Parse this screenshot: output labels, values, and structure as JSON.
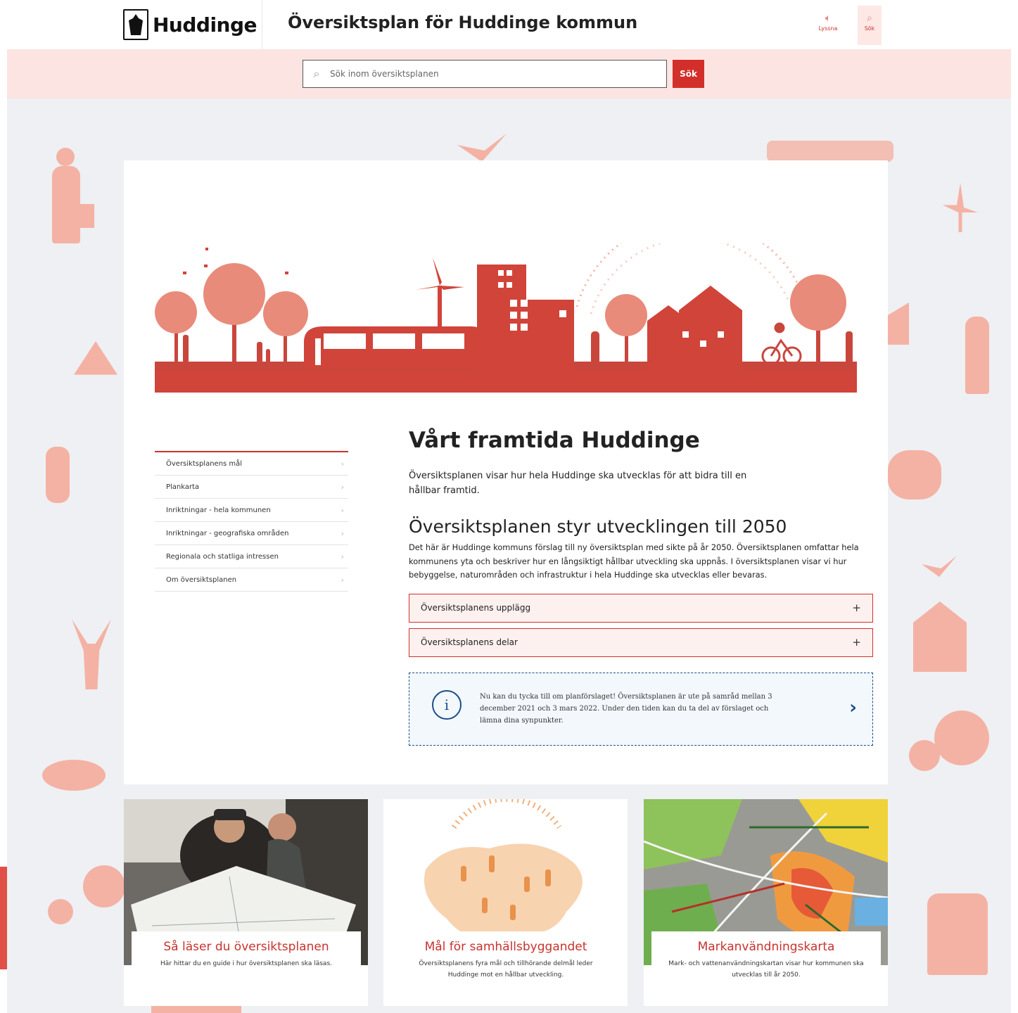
{
  "header": {
    "logo_text": "Huddinge",
    "title": "Översiktsplan för Huddinge kommun",
    "tools": [
      {
        "label": "Lyssna",
        "icon": "speaker-icon"
      },
      {
        "label": "Sök",
        "icon": "search-icon"
      }
    ]
  },
  "search": {
    "placeholder": "Sök inom översiktsplanen",
    "button_label": "Sök"
  },
  "sidenav": {
    "items": [
      {
        "label": "Översiktsplanens mål"
      },
      {
        "label": "Plankarta"
      },
      {
        "label": "Inriktningar - hela kommunen"
      },
      {
        "label": "Inriktningar - geografiska områden"
      },
      {
        "label": "Regionala och statliga intressen"
      },
      {
        "label": "Om översiktsplanen"
      }
    ]
  },
  "main": {
    "heading": "Vårt framtida Huddinge",
    "lead": "Översiktsplanen visar hur hela Huddinge ska utvecklas för att bidra till en hållbar framtid.",
    "subheading": "Översiktsplanen styr utvecklingen till 2050",
    "body": "Det här är Huddinge kommuns förslag till ny översiktsplan med sikte på år 2050. Översiktsplanen omfattar hela kommunens yta och beskriver hur en långsiktigt hållbar utveckling ska uppnås. I översiktsplanen visar vi hur bebyggelse, naturområden och infrastruktur i hela Huddinge ska utvecklas eller bevaras.",
    "accordions": [
      {
        "label": "Översiktsplanens upplägg",
        "toggle": "+"
      },
      {
        "label": "Översiktsplanens delar",
        "toggle": "+"
      }
    ],
    "notice": {
      "text": "Nu kan du tycka till om planförslaget! Översiktsplanen är ute på samråd mellan 3 december 2021 och 3 mars 2022. Under den tiden kan du ta del av förslaget och lämna dina synpunkter.",
      "arrow": "›",
      "icon_glyph": "i"
    }
  },
  "tiles": [
    {
      "title": "Så läser du översiktsplanen",
      "text": "Här hittar du en guide i hur översiktsplanen ska läsas."
    },
    {
      "title": "Mål för samhällsbyggandet",
      "text": "Översiktsplanens fyra mål och tillhörande delmål leder Huddinge mot en hållbar utveckling."
    },
    {
      "title": "Markanvändningskarta",
      "text": "Mark- och vattenanvändningskartan visar hur kommunen ska utvecklas till år 2050."
    }
  ],
  "colors": {
    "brand_red": "#d32f2a",
    "silhouette": "#f4b2a4",
    "info_blue": "#1b4f8a"
  }
}
